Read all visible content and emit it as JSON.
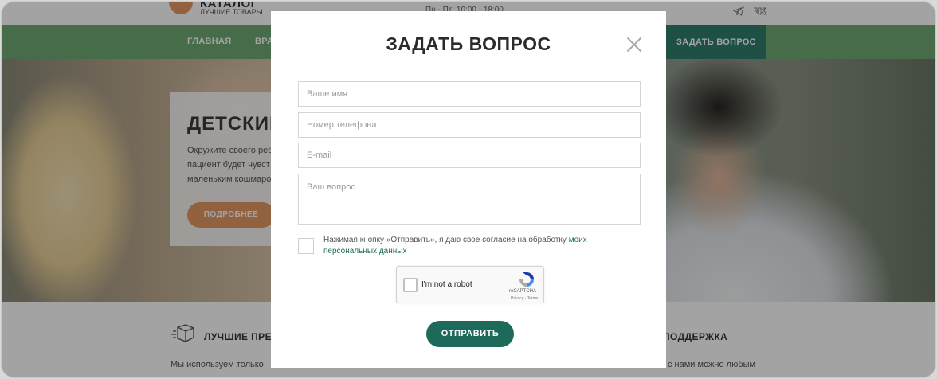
{
  "site": {
    "logo_title": "КАТАЛОГ",
    "logo_subtitle": "ЛУЧШИЕ ТОВАРЫ",
    "hours": "Пн - Пт: 10:00 - 18:00",
    "nav": {
      "home": "ГЛАВНАЯ",
      "doctors": "ВРА",
      "ask": "ЗАДАТЬ ВОПРОС"
    },
    "hero": {
      "title": "ДЕТСКИЙ",
      "text": "Окружите своего реб пациент будет чувст маленьким кошмаро",
      "button": "ПОДРОБНЕЕ"
    },
    "features": {
      "title_1": "ЛУЧШИЕ ПРЕПА",
      "text_1": "Мы используем только",
      "title_2": "ПОДДЕРЖКА",
      "text_2": "с нами можно любым"
    }
  },
  "modal": {
    "title": "ЗАДАТЬ ВОПРОС",
    "fields": {
      "name_placeholder": "Ваше имя",
      "phone_placeholder": "Номер телефона",
      "email_placeholder": "E-mail",
      "question_placeholder": "Ваш вопрос"
    },
    "consent_text": "Нажимая кнопку «Отправить», я даю свое согласие на обработку ",
    "consent_link": "моих персональных данных",
    "recaptcha": {
      "label": "I'm not a robot",
      "brand": "reCAPTCHA",
      "terms": "Privacy - Terms"
    },
    "submit": "ОТПРАВИТЬ"
  },
  "colors": {
    "nav_green": "#6faa74",
    "accent_dark_green": "#1e6a5a",
    "accent_orange": "#e59a64"
  }
}
